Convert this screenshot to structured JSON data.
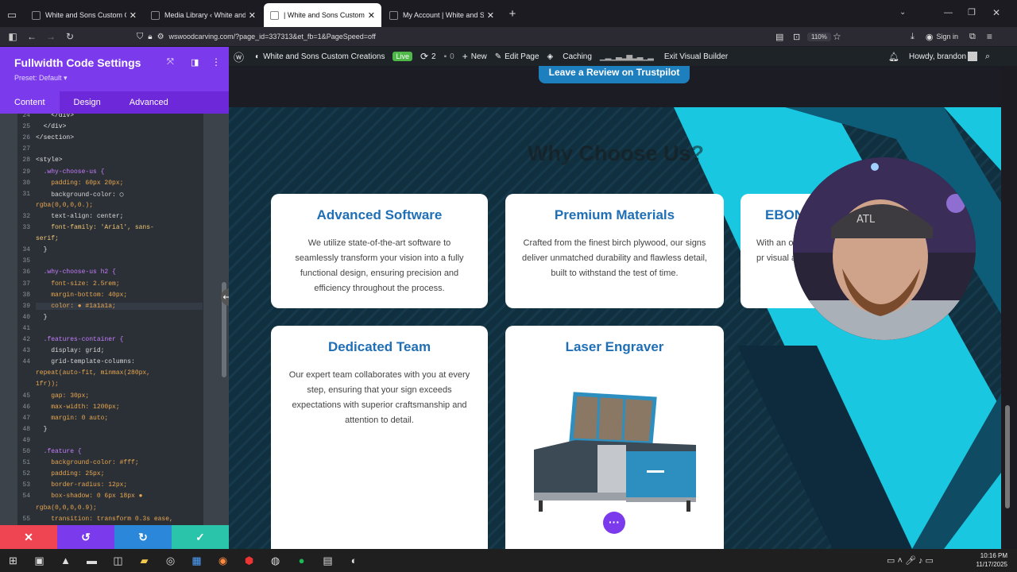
{
  "browser": {
    "tabs": [
      {
        "title": "White and Sons Custom Creatio",
        "active": false
      },
      {
        "title": "Media Library ‹ White and Sons",
        "active": false
      },
      {
        "title": "| White and Sons Custom Creat",
        "active": true
      },
      {
        "title": "My Account | White and Sons C",
        "active": false
      }
    ],
    "new_tab_label": "+",
    "url": "wswoodcarving.com/?page_id=337313&et_fb=1&PageSpeed=off",
    "zoom": "110%",
    "sign_in_label": "Sign in"
  },
  "wp_bar": {
    "site_name": "White and Sons Custom Creations",
    "live_label": "Live",
    "updates_count": "2",
    "comments_count": "0",
    "new_label": "New",
    "edit_page_label": "Edit Page",
    "caching_label": "Caching",
    "exit_builder_label": "Exit Visual Builder",
    "howdy_label": "Howdy, brandon"
  },
  "panel": {
    "title": "Fullwidth Code Settings",
    "preset": "Preset: Default ▾",
    "tabs": [
      "Content",
      "Design",
      "Advanced"
    ],
    "active_tab": "Content"
  },
  "code_lines": [
    {
      "n": "24",
      "t": "    </div>",
      "c": "br"
    },
    {
      "n": "25",
      "t": "  </div>",
      "c": "br"
    },
    {
      "n": "26",
      "t": "</section>",
      "c": "br"
    },
    {
      "n": "27",
      "t": "",
      "c": "br"
    },
    {
      "n": "28",
      "t": "<style>",
      "c": "br"
    },
    {
      "n": "29",
      "t": "  .why-choose-us {",
      "c": "sel"
    },
    {
      "n": "30",
      "t": "    padding: 60px 20px;",
      "c": "val"
    },
    {
      "n": "31",
      "t": "    background-color: ◯",
      "c": "prop"
    },
    {
      "n": "",
      "t": "rgba(0,0,0,0.);",
      "c": "val"
    },
    {
      "n": "32",
      "t": "    text-align: center;",
      "c": "prop"
    },
    {
      "n": "33",
      "t": "    font-family: 'Arial', sans-",
      "c": "str"
    },
    {
      "n": "",
      "t": "serif;",
      "c": "str"
    },
    {
      "n": "34",
      "t": "  }",
      "c": "br"
    },
    {
      "n": "35",
      "t": "",
      "c": "br"
    },
    {
      "n": "36",
      "t": "  .why-choose-us h2 {",
      "c": "sel"
    },
    {
      "n": "37",
      "t": "    font-size: 2.5rem;",
      "c": "val"
    },
    {
      "n": "38",
      "t": "    margin-bottom: 40px;",
      "c": "val"
    },
    {
      "n": "39",
      "t": "    color: ● #1a1a1a;",
      "c": "val"
    },
    {
      "n": "40",
      "t": "  }",
      "c": "br"
    },
    {
      "n": "41",
      "t": "",
      "c": "br"
    },
    {
      "n": "42",
      "t": "  .features-container {",
      "c": "sel"
    },
    {
      "n": "43",
      "t": "    display: grid;",
      "c": "prop"
    },
    {
      "n": "44",
      "t": "    grid-template-columns:",
      "c": "prop"
    },
    {
      "n": "",
      "t": "repeat(auto-fit, minmax(280px,",
      "c": "val"
    },
    {
      "n": "",
      "t": "1fr));",
      "c": "val"
    },
    {
      "n": "45",
      "t": "    gap: 30px;",
      "c": "val"
    },
    {
      "n": "46",
      "t": "    max-width: 1200px;",
      "c": "val"
    },
    {
      "n": "47",
      "t": "    margin: 0 auto;",
      "c": "val"
    },
    {
      "n": "48",
      "t": "  }",
      "c": "br"
    },
    {
      "n": "49",
      "t": "",
      "c": "br"
    },
    {
      "n": "50",
      "t": "  .feature {",
      "c": "sel"
    },
    {
      "n": "51",
      "t": "    background-color: #fff;",
      "c": "val"
    },
    {
      "n": "52",
      "t": "    padding: 25px;",
      "c": "val"
    },
    {
      "n": "53",
      "t": "    border-radius: 12px;",
      "c": "val"
    },
    {
      "n": "54",
      "t": "    box-shadow: 0 6px 18px ●",
      "c": "val"
    },
    {
      "n": "",
      "t": "rgba(0,0,0,0.9);",
      "c": "val"
    },
    {
      "n": "55",
      "t": "    transition: transform 0.3s ease,",
      "c": "val"
    }
  ],
  "page": {
    "trustpilot_button": "Leave a Review on Trustpilot",
    "section_title": "Why Choose Us?",
    "cards": [
      {
        "title": "Advanced Software",
        "text": "We utilize state-of-the-art software to seamlessly transform your vision into a fully functional design, ensuring precision and efficiency throughout the process."
      },
      {
        "title": "Premium Materials",
        "text": "Crafted from the finest birch plywood, our signs deliver unmatched durability and flawless detail, built to withstand the test of time."
      },
      {
        "title": "EBON",
        "text": "With an only pr visual ap"
      },
      {
        "title": "Dedicated Team",
        "text": "Our expert team collaborates with you at every step, ensuring that your sign exceeds expectations with superior craftsmanship and attention to detail."
      },
      {
        "title": "Laser Engraver",
        "text": ""
      }
    ],
    "more_button": "···"
  },
  "taskbar": {
    "time": "10:16 PM",
    "date": "11/17/2025"
  },
  "colors": {
    "panel_purple": "#7c3aed",
    "card_title_blue": "#1f6fb6",
    "accent_cyan": "#19c7e0"
  }
}
